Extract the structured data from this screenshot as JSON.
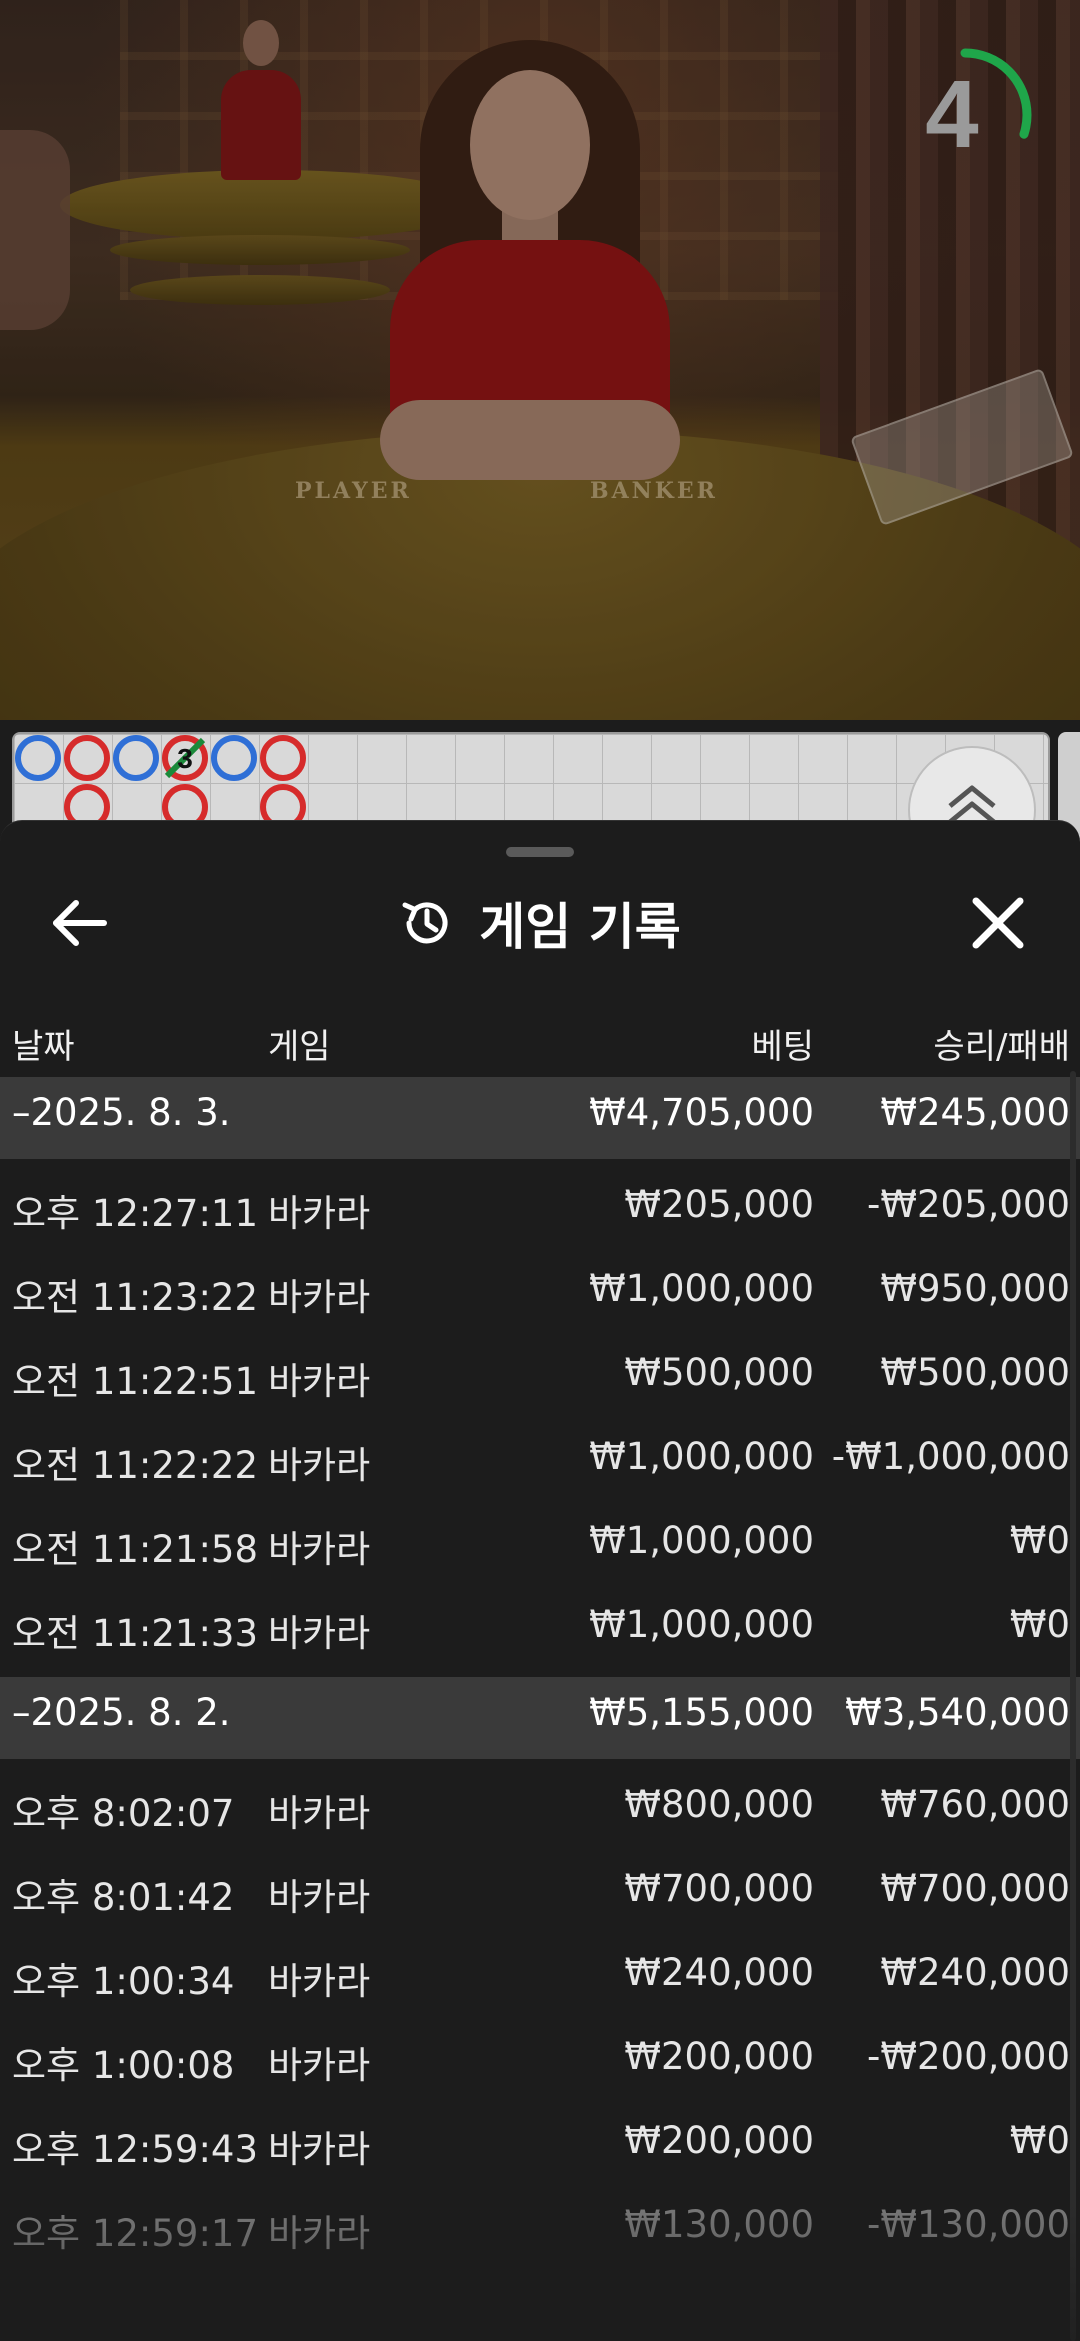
{
  "video": {
    "timer_value": "4",
    "timer_fraction": 0.3,
    "table_labels": {
      "player": "PLAYER",
      "banker": "BANKER"
    }
  },
  "roadmap": {
    "colors": {
      "player": "#2f6fd6",
      "banker": "#d62b2b",
      "tie_mark": "#1a8a3a"
    },
    "cells": [
      {
        "col": 0,
        "row": 0,
        "color": "player"
      },
      {
        "col": 1,
        "row": 0,
        "color": "banker"
      },
      {
        "col": 1,
        "row": 1,
        "color": "banker"
      },
      {
        "col": 2,
        "row": 0,
        "color": "player"
      },
      {
        "col": 3,
        "row": 0,
        "color": "banker",
        "tie_count": "3"
      },
      {
        "col": 3,
        "row": 1,
        "color": "banker"
      },
      {
        "col": 4,
        "row": 0,
        "color": "player"
      },
      {
        "col": 5,
        "row": 0,
        "color": "banker"
      },
      {
        "col": 5,
        "row": 1,
        "color": "banker"
      }
    ]
  },
  "sheet": {
    "title": "게임 기록",
    "icons": {
      "back": "arrow-left-icon",
      "history": "history-icon",
      "close": "close-icon",
      "expand": "chevron-up-double-icon"
    },
    "columns": {
      "date": "날짜",
      "game": "게임",
      "bet": "베팅",
      "win_loss": "승리/패배"
    },
    "groups": [
      {
        "date": "–2025. 8. 3.",
        "total_bet": "₩4,705,000",
        "total_win": "₩245,000",
        "rows": [
          {
            "time": "오후 12:27:11",
            "game": "바카라",
            "bet": "₩205,000",
            "win": "-₩205,000"
          },
          {
            "time": "오전 11:23:22",
            "game": "바카라",
            "bet": "₩1,000,000",
            "win": "₩950,000"
          },
          {
            "time": "오전 11:22:51",
            "game": "바카라",
            "bet": "₩500,000",
            "win": "₩500,000"
          },
          {
            "time": "오전 11:22:22",
            "game": "바카라",
            "bet": "₩1,000,000",
            "win": "-₩1,000,000"
          },
          {
            "time": "오전 11:21:58",
            "game": "바카라",
            "bet": "₩1,000,000",
            "win": "₩0"
          },
          {
            "time": "오전 11:21:33",
            "game": "바카라",
            "bet": "₩1,000,000",
            "win": "₩0"
          }
        ]
      },
      {
        "date": "–2025. 8. 2.",
        "total_bet": "₩5,155,000",
        "total_win": "₩3,540,000",
        "rows": [
          {
            "time": "오후 8:02:07",
            "game": "바카라",
            "bet": "₩800,000",
            "win": "₩760,000"
          },
          {
            "time": "오후 8:01:42",
            "game": "바카라",
            "bet": "₩700,000",
            "win": "₩700,000"
          },
          {
            "time": "오후 1:00:34",
            "game": "바카라",
            "bet": "₩240,000",
            "win": "₩240,000"
          },
          {
            "time": "오후 1:00:08",
            "game": "바카라",
            "bet": "₩200,000",
            "win": "-₩200,000"
          },
          {
            "time": "오후 12:59:43",
            "game": "바카라",
            "bet": "₩200,000",
            "win": "₩0"
          },
          {
            "time": "오후 12:59:17",
            "game": "바카라",
            "bet": "₩130,000",
            "win": "-₩130,000"
          }
        ]
      }
    ]
  }
}
